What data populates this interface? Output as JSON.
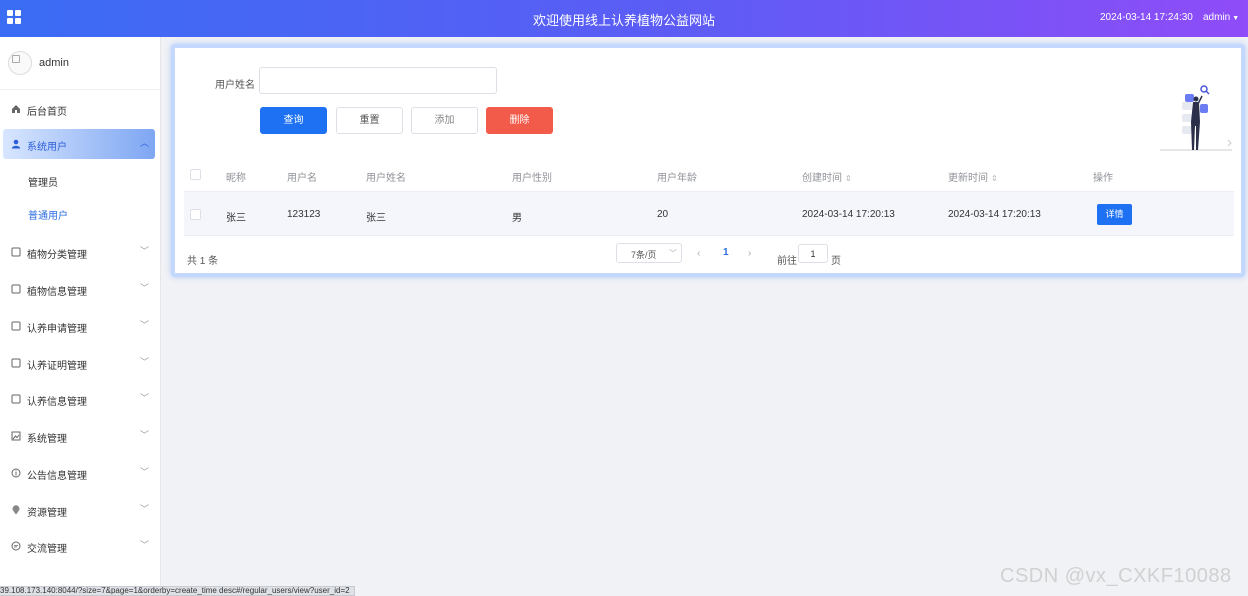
{
  "header": {
    "title": "欢迎使用线上认养植物公益网站",
    "datetime": "2024-03-14 17:24:30",
    "user": "admin"
  },
  "sidebar": {
    "username": "admin",
    "items": [
      {
        "label": "后台首页",
        "icon": "home-icon"
      },
      {
        "label": "系统用户",
        "icon": "user-icon",
        "expanded": true,
        "children": [
          {
            "label": "管理员"
          },
          {
            "label": "普通用户",
            "current": true
          }
        ]
      },
      {
        "label": "植物分类管理",
        "icon": "doc-icon"
      },
      {
        "label": "植物信息管理",
        "icon": "doc-icon"
      },
      {
        "label": "认养申请管理",
        "icon": "doc-icon"
      },
      {
        "label": "认养证明管理",
        "icon": "doc-icon"
      },
      {
        "label": "认养信息管理",
        "icon": "doc-icon"
      },
      {
        "label": "系统管理",
        "icon": "picture-icon"
      },
      {
        "label": "公告信息管理",
        "icon": "info-icon"
      },
      {
        "label": "资源管理",
        "icon": "location-icon"
      },
      {
        "label": "交流管理",
        "icon": "chat-icon"
      }
    ]
  },
  "search": {
    "label": "用户姓名",
    "value": "",
    "placeholder": ""
  },
  "buttons": {
    "query": "查询",
    "reset": "重置",
    "add": "添加",
    "delete": "删除"
  },
  "table": {
    "headers": [
      "昵称",
      "用户名",
      "用户姓名",
      "用户性别",
      "用户年龄",
      "创建时间",
      "更新时间",
      "操作"
    ],
    "rows": [
      {
        "nickname": "张三",
        "username": "123123",
        "realname": "张三",
        "gender": "男",
        "age": "20",
        "created": "2024-03-14 17:20:13",
        "updated": "2024-03-14 17:20:13",
        "action": "详情"
      }
    ]
  },
  "pagination": {
    "total": "共 1 条",
    "page_size": "7条/页",
    "current_page": "1",
    "goto_label": "前往",
    "goto_value": "1",
    "goto_suffix": "页"
  },
  "status_url": "39.108.173.140:8044/?size=7&page=1&orderby=create_time desc#/regular_users/view?user_id=2",
  "watermark": "CSDN @vx_CXKF10088",
  "colors": {
    "header_start": "#3a6cf4",
    "header_end": "#8f4cf8",
    "primary": "#1d71f2",
    "danger": "#f25a4a"
  }
}
